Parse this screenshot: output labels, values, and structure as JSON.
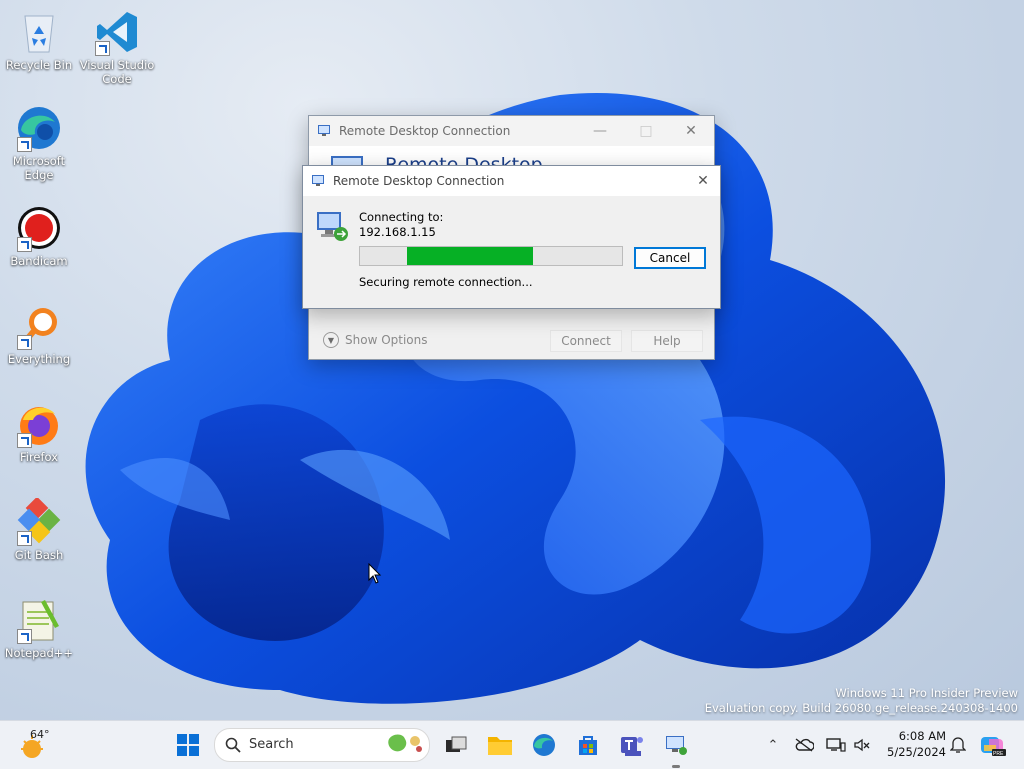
{
  "desktop": {
    "icons": [
      {
        "label": "Recycle Bin"
      },
      {
        "label": "Visual Studio Code"
      },
      {
        "label": "Microsoft Edge"
      },
      {
        "label": "Bandicam"
      },
      {
        "label": "Everything"
      },
      {
        "label": "Firefox"
      },
      {
        "label": "Git Bash"
      },
      {
        "label": "Notepad++"
      }
    ],
    "watermark": {
      "line1": "Windows 11 Pro Insider Preview",
      "line2": "Evaluation copy. Build 26080.ge_release.240308-1400"
    }
  },
  "rdc_main": {
    "title": "Remote Desktop Connection",
    "heading": "Remote Desktop",
    "show_options": "Show Options",
    "connect": "Connect",
    "help": "Help"
  },
  "rdc_dialog": {
    "title": "Remote Desktop Connection",
    "connecting_label": "Connecting to:",
    "address": "192.168.1.15",
    "cancel": "Cancel",
    "status": "Securing remote connection...",
    "progress": {
      "start": 0.18,
      "end": 0.66
    }
  },
  "taskbar": {
    "weather_temp": "64°",
    "search_placeholder": "Search",
    "time": "6:08 AM",
    "date": "5/25/2024",
    "colors": {
      "accent": "#0078d4",
      "progress": "#06b025"
    }
  }
}
